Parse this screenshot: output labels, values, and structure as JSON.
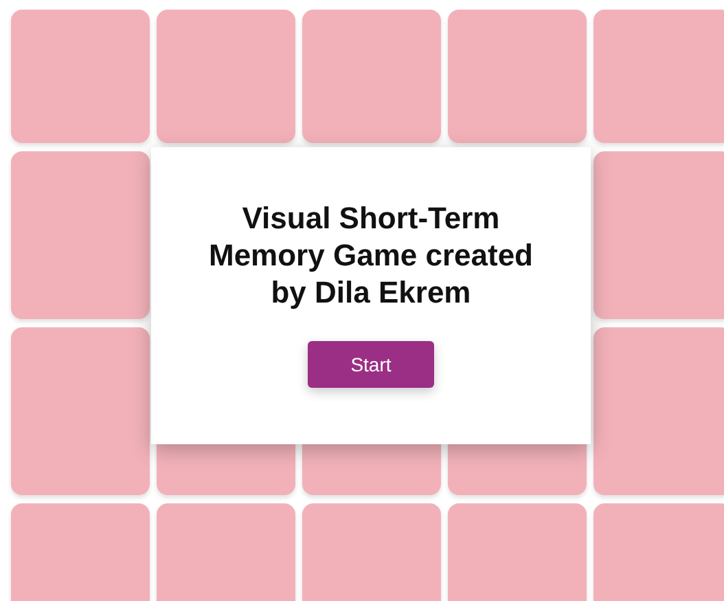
{
  "dialog": {
    "title": "Visual Short-Term Memory Game created by Dila Ekrem",
    "button": "Start"
  }
}
